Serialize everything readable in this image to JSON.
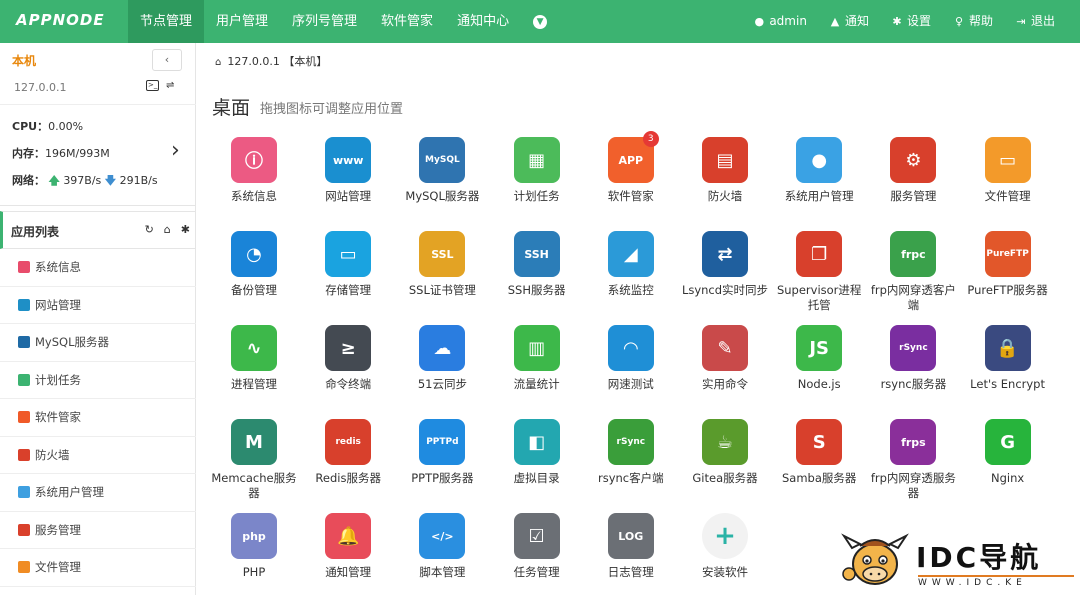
{
  "app": {
    "logo": "APPNODE"
  },
  "nav": {
    "items": [
      "节点管理",
      "用户管理",
      "序列号管理",
      "软件管家",
      "通知中心"
    ],
    "right": [
      {
        "label": "admin",
        "icon": "user-icon"
      },
      {
        "label": "通知",
        "icon": "bell-icon"
      },
      {
        "label": "设置",
        "icon": "gear-icon"
      },
      {
        "label": "帮助",
        "icon": "lightbulb-icon"
      },
      {
        "label": "退出",
        "icon": "logout-icon"
      }
    ]
  },
  "host": {
    "name": "本机",
    "ip": "127.0.0.1",
    "cpu_label": "CPU：",
    "cpu_value": "0.00%",
    "mem_label": "内存：",
    "mem_value": "196M/993M",
    "net_label": "网络：",
    "net_up": "397B/s",
    "net_down": "291B/s"
  },
  "app_list": {
    "title": "应用列表",
    "items": [
      {
        "label": "系统信息",
        "color": "#e84c6b"
      },
      {
        "label": "网站管理",
        "color": "#1e8fc6"
      },
      {
        "label": "MySQL服务器",
        "color": "#1f6aa5"
      },
      {
        "label": "计划任务",
        "color": "#3cb371"
      },
      {
        "label": "软件管家",
        "color": "#f05a28"
      },
      {
        "label": "防火墙",
        "color": "#d9402b"
      },
      {
        "label": "系统用户管理",
        "color": "#3e9fe0"
      },
      {
        "label": "服务管理",
        "color": "#d9402b"
      },
      {
        "label": "文件管理",
        "color": "#f08c24"
      }
    ]
  },
  "breadcrumb": {
    "text": "127.0.0.1 【本机】"
  },
  "desktop": {
    "title": "桌面",
    "subtitle": "拖拽图标可调整应用位置"
  },
  "apps": [
    {
      "label": "系统信息",
      "color": "#ec5a83",
      "glyph": "ⓘ"
    },
    {
      "label": "网站管理",
      "color": "#1a8fd0",
      "glyph": "www"
    },
    {
      "label": "MySQL服务器",
      "color": "#2f74b0",
      "glyph": "MySQL"
    },
    {
      "label": "计划任务",
      "color": "#4cbb5a",
      "glyph": "▦"
    },
    {
      "label": "软件管家",
      "color": "#f1602c",
      "glyph": "APP",
      "badge": "3"
    },
    {
      "label": "防火墙",
      "color": "#d8402c",
      "glyph": "▤"
    },
    {
      "label": "系统用户管理",
      "color": "#3aa2e4",
      "glyph": "●"
    },
    {
      "label": "服务管理",
      "color": "#d8402c",
      "glyph": "⚙"
    },
    {
      "label": "文件管理",
      "color": "#f39a2a",
      "glyph": "▭"
    },
    {
      "label": "备份管理",
      "color": "#1a84d8",
      "glyph": "◔"
    },
    {
      "label": "存储管理",
      "color": "#1aa3e0",
      "glyph": "▭"
    },
    {
      "label": "SSL证书管理",
      "color": "#e3a324",
      "glyph": "SSL"
    },
    {
      "label": "SSH服务器",
      "color": "#2b7db8",
      "glyph": "SSH"
    },
    {
      "label": "系统监控",
      "color": "#2b9ad8",
      "glyph": "◢"
    },
    {
      "label": "Lsyncd实时同步",
      "color": "#1f5f9e",
      "glyph": "⇄"
    },
    {
      "label": "Supervisor进程托管",
      "color": "#d8402c",
      "glyph": "❐"
    },
    {
      "label": "frp内网穿透客户端",
      "color": "#3aa14b",
      "glyph": "frpc"
    },
    {
      "label": "PureFTP服务器",
      "color": "#e2572a",
      "glyph": "PureFTP"
    },
    {
      "label": "进程管理",
      "color": "#3db84a",
      "glyph": "∿"
    },
    {
      "label": "命令终端",
      "color": "#444a52",
      "glyph": "≥"
    },
    {
      "label": "51云同步",
      "color": "#2a7de0",
      "glyph": "☁"
    },
    {
      "label": "流量统计",
      "color": "#3db84a",
      "glyph": "▥"
    },
    {
      "label": "网速测试",
      "color": "#1f8fd6",
      "glyph": "◠"
    },
    {
      "label": "实用命令",
      "color": "#c94a4a",
      "glyph": "✎"
    },
    {
      "label": "Node.js",
      "color": "#3db84a",
      "glyph": "JS"
    },
    {
      "label": "rsync服务器",
      "color": "#7a2ea0",
      "glyph": "rSync"
    },
    {
      "label": "Let's Encrypt",
      "color": "#3a4a80",
      "glyph": "🔒"
    },
    {
      "label": "Memcache服务器",
      "color": "#2c8a6f",
      "glyph": "M"
    },
    {
      "label": "Redis服务器",
      "color": "#d8402c",
      "glyph": "redis"
    },
    {
      "label": "PPTP服务器",
      "color": "#1f8be0",
      "glyph": "PPTPd"
    },
    {
      "label": "虚拟目录",
      "color": "#23a7b0",
      "glyph": "◧"
    },
    {
      "label": "rsync客户端",
      "color": "#3a9e3a",
      "glyph": "rSync"
    },
    {
      "label": "Gitea服务器",
      "color": "#5a9b2c",
      "glyph": "☕"
    },
    {
      "label": "Samba服务器",
      "color": "#d8402c",
      "glyph": "S"
    },
    {
      "label": "frp内网穿透服务器",
      "color": "#8a2f9a",
      "glyph": "frps"
    },
    {
      "label": "Nginx",
      "color": "#27b43c",
      "glyph": "G"
    },
    {
      "label": "PHP",
      "color": "#7b86c9",
      "glyph": "php"
    },
    {
      "label": "通知管理",
      "color": "#e84c5a",
      "glyph": "🔔"
    },
    {
      "label": "脚本管理",
      "color": "#2a8fe0",
      "glyph": "</>"
    },
    {
      "label": "任务管理",
      "color": "#6b6f75",
      "glyph": "☑"
    },
    {
      "label": "日志管理",
      "color": "#6b6f75",
      "glyph": "LOG"
    },
    {
      "label": "安装软件",
      "color": "#f2f2f2",
      "glyph": "+"
    }
  ],
  "watermark": {
    "title": "IDC导航",
    "url": "WWW.IDC.KE"
  }
}
